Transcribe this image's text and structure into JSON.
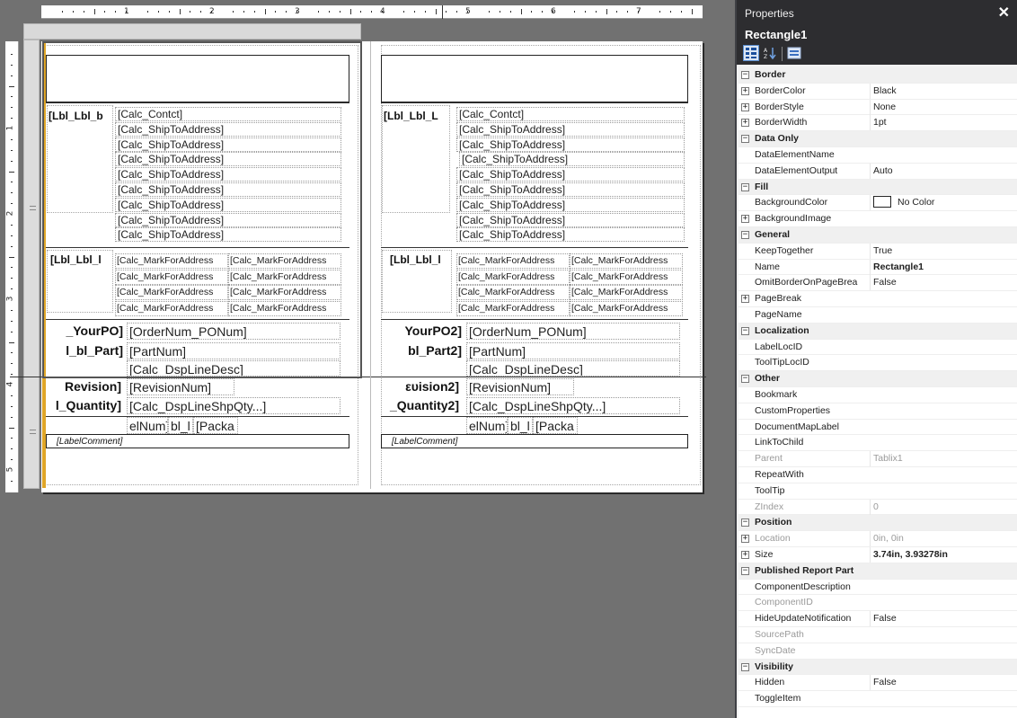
{
  "ruler": {
    "h_numbers": [
      "1",
      "2",
      "3",
      "4",
      "5",
      "6",
      "7"
    ],
    "v_numbers": [
      "1",
      "2",
      "3",
      "4",
      "5"
    ]
  },
  "report": {
    "left": {
      "contact_label": "[Lbl_Lbl_b",
      "ship_fields": [
        "[Calc_Contct]",
        "[Calc_ShipToAddress]",
        "[Calc_ShipToAddress]",
        "[Calc_ShipToAddress]",
        "[Calc_ShipToAddress]",
        "[Calc_ShipToAddress]",
        "[Calc_ShipToAddress]",
        "[Calc_ShipToAddress]",
        "[Calc_ShipToAddress]"
      ],
      "mark_label": "[Lbl_Lbl_l",
      "mark_fields": [
        "[Calc_MarkForAddress",
        "[Calc_MarkForAddress",
        "[Calc_MarkForAddress",
        "[Calc_MarkForAddress",
        "[Calc_MarkForAddress",
        "[Calc_MarkForAddress",
        "[Calc_MarkForAddress",
        "[Calc_MarkForAddress"
      ],
      "po_label": "_YourPO]",
      "po_field": "[OrderNum_PONum]",
      "part_label": "l_bl_Part]",
      "part_field": "[PartNum]",
      "desc_field": "[Calc_DspLineDesc]",
      "rev_label": "Revision]",
      "rev_field": "[RevisionNum]",
      "qty_label": "l_Quantity]",
      "qty_field": "[Calc_DspLineShpQty...]",
      "pkg_a": "elNum]",
      "pkg_b": "bl_l",
      "pkg_c": "[Packa",
      "comment": "[LabelComment]"
    },
    "right": {
      "contact_label": "[Lbl_Lbl_L",
      "ship_fields": [
        "[Calc_Contct]",
        "[Calc_ShipToAddress]",
        "[Calc_ShipToAddress]",
        "[Calc_ShipToAddress]",
        "[Calc_ShipToAddress]",
        "[Calc_ShipToAddress]",
        "[Calc_ShipToAddress]",
        "[Calc_ShipToAddress]",
        "[Calc_ShipToAddress]"
      ],
      "mark_label": "[Lbl_Lbl_l",
      "mark_fields": [
        "[Calc_MarkForAddress",
        "[Calc_MarkForAddress",
        "[Calc_MarkForAddress",
        "[Calc_MarkForAddress",
        "[Calc_MarkForAddress",
        "[Calc_MarkForAddress",
        "[Calc_MarkForAddress",
        "[Calc_MarkForAddress"
      ],
      "po_label": "YourPO2]",
      "po_field": "[OrderNum_PONum]",
      "part_label": "bl_Part2]",
      "part_field": "[PartNum]",
      "desc_field": "[Calc_DspLineDesc]",
      "rev_label": "ευision2]",
      "rev_field": "[RevisionNum]",
      "qty_label": "_Quantity2]",
      "qty_field": "[Calc_DspLineShpQty...]",
      "pkg_a": "elNum]",
      "pkg_b": "bl_l",
      "pkg_c": "[Packa",
      "comment": "[LabelComment]"
    }
  },
  "properties": {
    "panel_title": "Properties",
    "object_name": "Rectangle1",
    "toolbar": {
      "icons": [
        "categorized-icon",
        "alphabetical-icon",
        "property-pages-icon"
      ]
    },
    "rows": [
      {
        "type": "cat",
        "name": "Border"
      },
      {
        "type": "prop",
        "name": "BorderColor",
        "value": "Black",
        "expand": true
      },
      {
        "type": "prop",
        "name": "BorderStyle",
        "value": "None",
        "expand": true
      },
      {
        "type": "prop",
        "name": "BorderWidth",
        "value": "1pt",
        "expand": true
      },
      {
        "type": "cat",
        "name": "Data Only"
      },
      {
        "type": "prop",
        "name": "DataElementName",
        "value": ""
      },
      {
        "type": "prop",
        "name": "DataElementOutput",
        "value": "Auto"
      },
      {
        "type": "cat",
        "name": "Fill"
      },
      {
        "type": "prop",
        "name": "BackgroundColor",
        "value": "No Color",
        "swatch": true
      },
      {
        "type": "prop",
        "name": "BackgroundImage",
        "value": "",
        "expand": true
      },
      {
        "type": "cat",
        "name": "General"
      },
      {
        "type": "prop",
        "name": "KeepTogether",
        "value": "True"
      },
      {
        "type": "prop",
        "name": "Name",
        "value": "Rectangle1",
        "bold": true
      },
      {
        "type": "prop",
        "name": "OmitBorderOnPageBrea",
        "value": "False"
      },
      {
        "type": "prop",
        "name": "PageBreak",
        "value": "",
        "expand": true
      },
      {
        "type": "prop",
        "name": "PageName",
        "value": ""
      },
      {
        "type": "cat",
        "name": "Localization"
      },
      {
        "type": "prop",
        "name": "LabelLocID",
        "value": ""
      },
      {
        "type": "prop",
        "name": "ToolTipLocID",
        "value": ""
      },
      {
        "type": "cat",
        "name": "Other"
      },
      {
        "type": "prop",
        "name": "Bookmark",
        "value": ""
      },
      {
        "type": "prop",
        "name": "CustomProperties",
        "value": ""
      },
      {
        "type": "prop",
        "name": "DocumentMapLabel",
        "value": ""
      },
      {
        "type": "prop",
        "name": "LinkToChild",
        "value": ""
      },
      {
        "type": "prop",
        "name": "Parent",
        "value": "Tablix1",
        "dim": true
      },
      {
        "type": "prop",
        "name": "RepeatWith",
        "value": ""
      },
      {
        "type": "prop",
        "name": "ToolTip",
        "value": ""
      },
      {
        "type": "prop",
        "name": "ZIndex",
        "value": "0",
        "dim": true
      },
      {
        "type": "cat",
        "name": "Position"
      },
      {
        "type": "prop",
        "name": "Location",
        "value": "0in, 0in",
        "expand": true,
        "dim": true
      },
      {
        "type": "prop",
        "name": "Size",
        "value": "3.74in, 3.93278in",
        "expand": true,
        "bold": true
      },
      {
        "type": "cat",
        "name": "Published Report Part"
      },
      {
        "type": "prop",
        "name": "ComponentDescription",
        "value": ""
      },
      {
        "type": "prop",
        "name": "ComponentID",
        "value": "",
        "dim": true
      },
      {
        "type": "prop",
        "name": "HideUpdateNotification",
        "value": "False"
      },
      {
        "type": "prop",
        "name": "SourcePath",
        "value": "",
        "dim": true
      },
      {
        "type": "prop",
        "name": "SyncDate",
        "value": "",
        "dim": true
      },
      {
        "type": "cat",
        "name": "Visibility"
      },
      {
        "type": "prop",
        "name": "Hidden",
        "value": "False"
      },
      {
        "type": "prop",
        "name": "ToggleItem",
        "value": ""
      }
    ]
  },
  "colors": {
    "accent": "#e0a628",
    "titlebar": "#2d2d30",
    "selection_blue": "#5a8ed0"
  }
}
